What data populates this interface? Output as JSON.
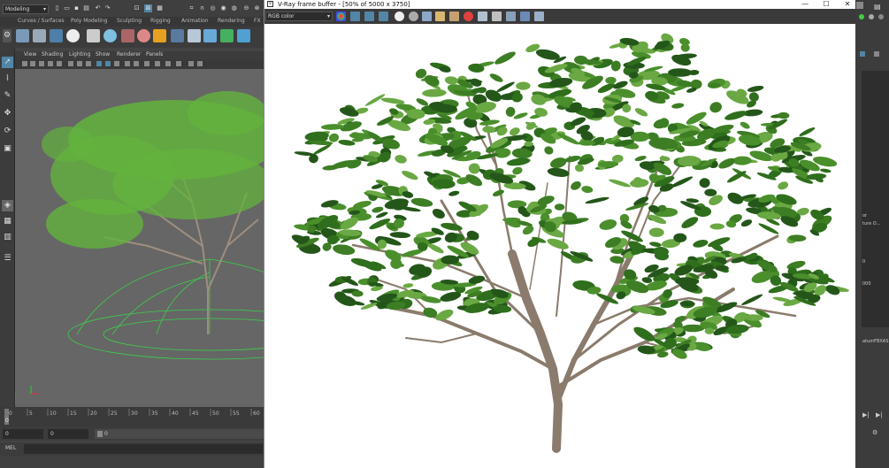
{
  "app": {
    "mode": "Modeling",
    "shelf_tabs": [
      "Curves / Surfaces",
      "Poly Modeling",
      "Sculpting",
      "Rigging",
      "Animation",
      "Rendering",
      "FX"
    ]
  },
  "viewport": {
    "menu": [
      "View",
      "Shading",
      "Lighting",
      "Show",
      "Renderer",
      "Panels"
    ]
  },
  "timeline": {
    "ticks": [
      "0",
      "5",
      "10",
      "15",
      "20",
      "25",
      "30",
      "35",
      "40",
      "45",
      "50",
      "55",
      "60"
    ],
    "current_frame": "0"
  },
  "range": {
    "start": "0",
    "playback_start": "0",
    "slider_start": "0"
  },
  "mel": {
    "label": "MEL"
  },
  "right_panel": {
    "text1": "or",
    "text2": "ture O...",
    "text3": "0",
    "text4": "000",
    "text5": "atumFBXAS"
  },
  "vfb": {
    "title": "V-Ray frame buffer - [50% of 5000 x 3750]",
    "channel": "RGB color",
    "window_buttons": [
      "—",
      "☐",
      "✕"
    ]
  },
  "colors": {
    "accent": "#5285a6",
    "leaf_dark": "#2f6e1c",
    "leaf_mid": "#4a8f2c",
    "leaf_light": "#6aa843",
    "bark": "#8a7b6c",
    "vp_leaf": "#63b33d",
    "wire": "#3bd14a"
  }
}
